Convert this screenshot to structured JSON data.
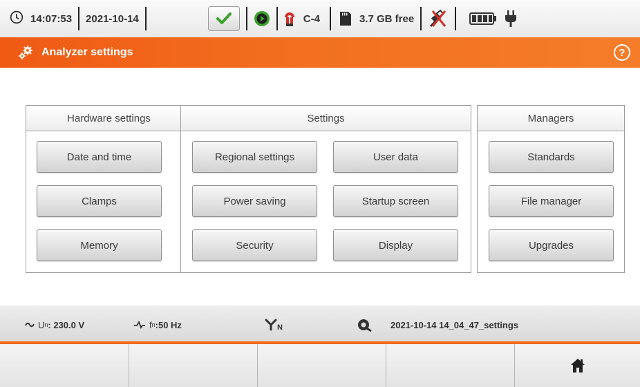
{
  "status": {
    "time": "14:07:53",
    "date": "2021-10-14",
    "clamp_label": "C-4",
    "storage_text": "3.7 GB free"
  },
  "title_bar": {
    "title": "Analyzer settings",
    "help_glyph": "?"
  },
  "groups": {
    "hardware": {
      "heading": "Hardware settings",
      "buttons": [
        "Date and time",
        "Clamps",
        "Memory"
      ]
    },
    "settings": {
      "heading": "Settings",
      "buttons": [
        "Regional settings",
        "User data",
        "Power saving",
        "Startup screen",
        "Security",
        "Display"
      ]
    },
    "managers": {
      "heading": "Managers",
      "buttons": [
        "Standards",
        "File manager",
        "Upgrades"
      ]
    }
  },
  "info_bar": {
    "voltage_prefix": "U",
    "voltage_sub": "n",
    "voltage_value": ": 230.0 V",
    "freq_prefix": "f",
    "freq_sub": "n",
    "freq_value": ":50 Hz",
    "network_sub": "N",
    "config_name": "2021-10-14 14_04_47_settings"
  },
  "icons": {
    "clock": "clock-icon",
    "ok": "checkmark-icon",
    "record": "play-circle-icon",
    "clamp": "clamp-icon",
    "sd_card": "sd-card-icon",
    "usb": "usb-disconnected-icon",
    "battery": "battery-icon",
    "plug": "power-plug-icon",
    "gears": "gears-icon",
    "help": "help-icon",
    "home": "home-icon"
  },
  "colors": {
    "accent_orange": "#f26a1a",
    "ok_green": "#3aa12a",
    "clamp_red": "#d0302a"
  }
}
